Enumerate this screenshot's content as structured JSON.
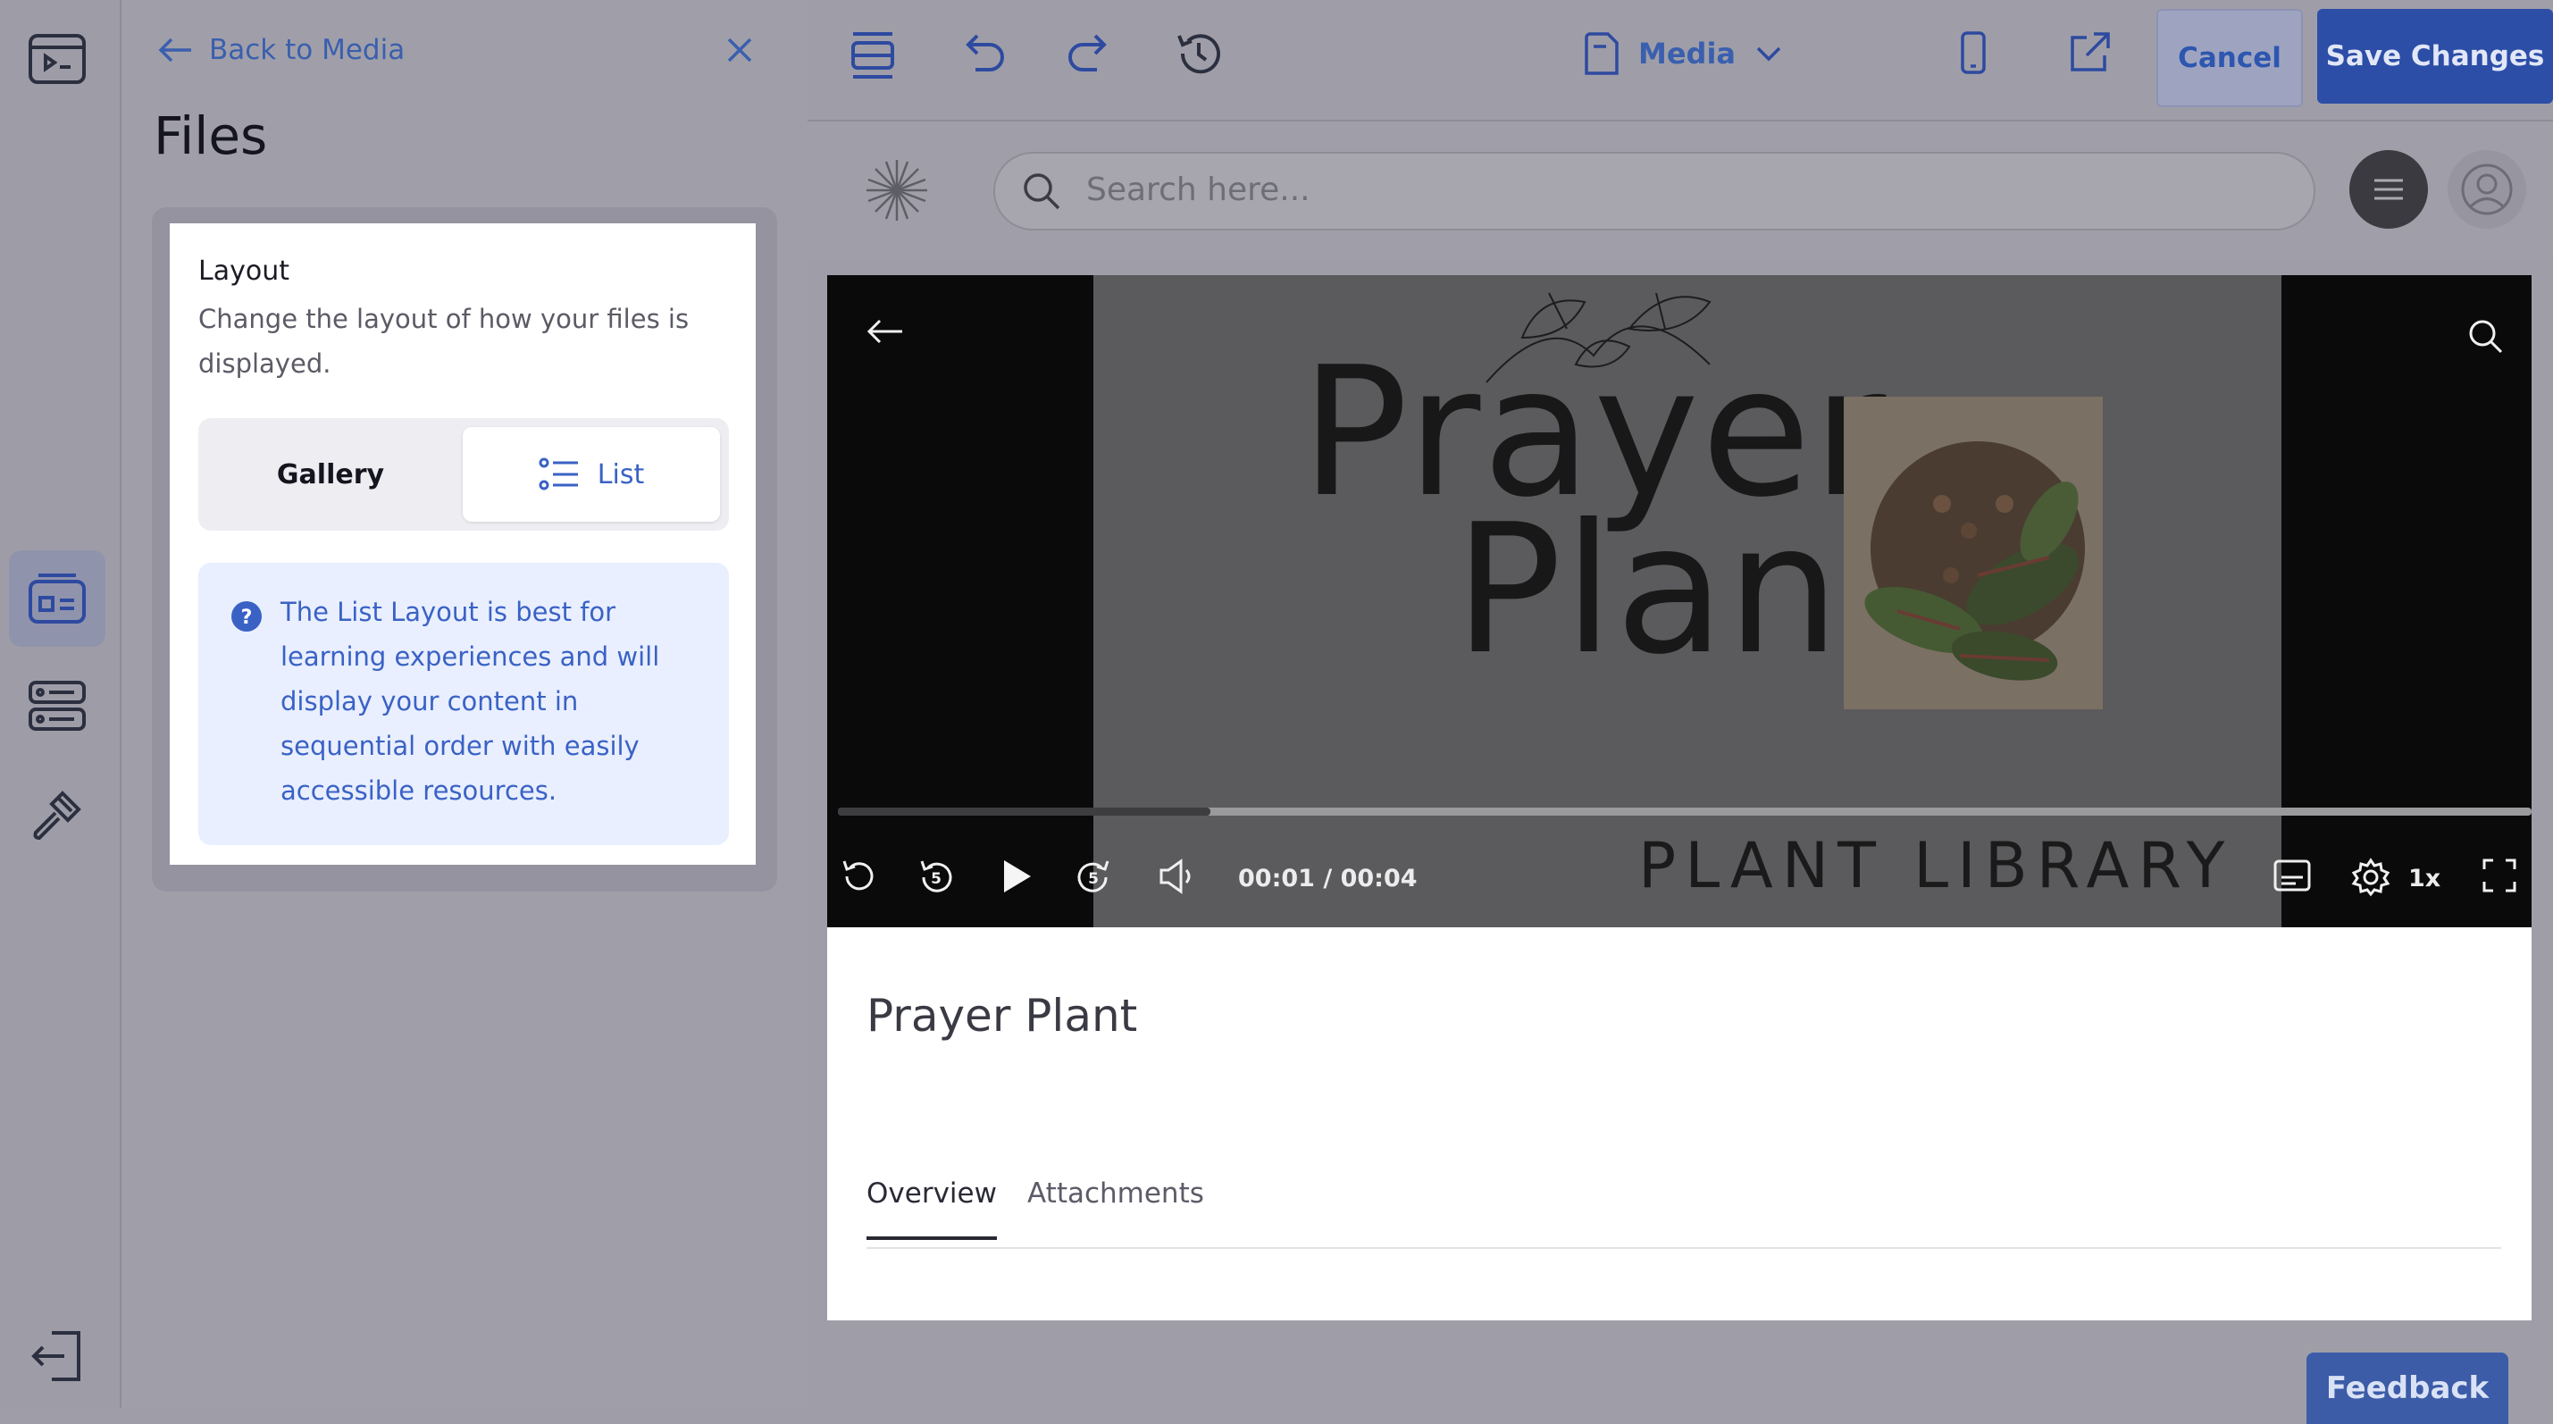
{
  "colors": {
    "accent": "#3a5fae",
    "primary_button": "#2c4ea7",
    "info_bg": "#e9efff",
    "overlay": "#9f9ea8"
  },
  "rail": {
    "items": [
      {
        "icon": "preview-icon"
      },
      {
        "icon": "layout-panel-icon",
        "active": true
      },
      {
        "icon": "list-settings-icon"
      },
      {
        "icon": "brush-icon"
      },
      {
        "icon": "exit-icon"
      }
    ]
  },
  "panel": {
    "back_label": "Back to Media",
    "title": "Files",
    "layout_label": "Layout",
    "layout_desc": "Change the layout of how your files is displayed.",
    "options": {
      "gallery": "Gallery",
      "list": "List",
      "selected": "List"
    },
    "info_text": "The List Layout is best for learning experiences and will display your content in sequential order with easily accessible resources."
  },
  "topbar": {
    "media_label": "Media",
    "cancel_label": "Cancel",
    "save_label": "Save Changes"
  },
  "preview": {
    "search_placeholder": "Search here...",
    "video": {
      "title_line1": "Prayer",
      "title_line2": "Plant",
      "subtitle": "PLANT LIBRARY",
      "time": "00:01 / 00:04",
      "speed": "1x",
      "progress": 0.22
    },
    "content_title": "Prayer Plant",
    "tabs": [
      {
        "label": "Overview",
        "active": true
      },
      {
        "label": "Attachments",
        "active": false
      }
    ],
    "feedback_label": "Feedback"
  }
}
